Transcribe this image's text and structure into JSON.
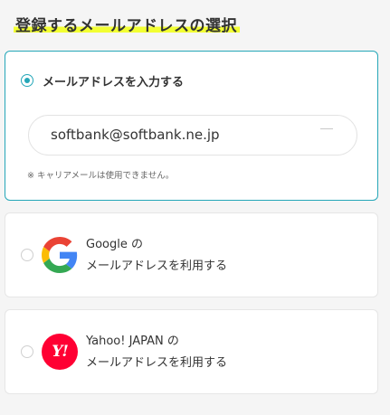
{
  "section": {
    "title": "登録するメールアドレスの選択"
  },
  "options": {
    "email": {
      "label": "メールアドレスを入力する",
      "input_value": "softbank@softbank.ne.jp",
      "note": "※ キャリアメールは使用できません。",
      "selected": true
    },
    "google": {
      "line1": "Google の",
      "line2": "メールアドレスを利用する",
      "icon": "google-logo-icon",
      "selected": false
    },
    "yahoo": {
      "line1": "Yahoo! JAPAN の",
      "line2": "メールアドレスを利用する",
      "icon": "yahoo-japan-logo-icon",
      "logo_text": "Y!",
      "selected": false
    }
  },
  "colors": {
    "accent": "#25a7b8",
    "highlight": "#f2ff33",
    "yahoo_red": "#ff0033",
    "google_blue": "#4285F4",
    "google_red": "#EA4335",
    "google_yellow": "#FBBC05",
    "google_green": "#34A853"
  }
}
